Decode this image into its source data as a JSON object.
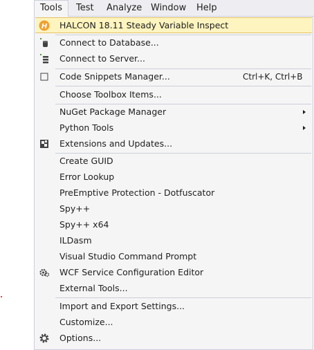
{
  "menubar": {
    "items": [
      {
        "label": "Tools"
      },
      {
        "label": "Test"
      },
      {
        "label": "Analyze"
      },
      {
        "label": "Window"
      },
      {
        "label": "Help"
      }
    ]
  },
  "tools_menu": {
    "items": [
      {
        "label": "HALCON 18.11 Steady Variable Inspect",
        "icon": "halcon-icon"
      },
      {
        "label": "Connect to Database...",
        "icon": "database-icon"
      },
      {
        "label": "Connect to Server...",
        "icon": "server-icon"
      },
      {
        "label": "Code Snippets Manager...",
        "shortcut": "Ctrl+K, Ctrl+B",
        "icon": "checkbox-icon"
      },
      {
        "label": "Choose Toolbox Items..."
      },
      {
        "label": "NuGet Package Manager",
        "submenu": true
      },
      {
        "label": "Python Tools",
        "submenu": true
      },
      {
        "label": "Extensions and Updates...",
        "icon": "extensions-icon"
      },
      {
        "label": "Create GUID"
      },
      {
        "label": "Error Lookup"
      },
      {
        "label": "PreEmptive Protection - Dotfuscator"
      },
      {
        "label": "Spy++"
      },
      {
        "label": "Spy++ x64"
      },
      {
        "label": "ILDasm"
      },
      {
        "label": "Visual Studio Command Prompt"
      },
      {
        "label": "WCF Service Configuration Editor",
        "icon": "wcf-gear-icon"
      },
      {
        "label": "External Tools..."
      },
      {
        "label": "Import and Export Settings..."
      },
      {
        "label": "Customize..."
      },
      {
        "label": "Options...",
        "icon": "gear-icon"
      }
    ]
  },
  "colors": {
    "menubar_bg": "#eeeef2",
    "menu_bg": "#f5f5f5",
    "highlight_bg": "#fdf4bf",
    "highlight_border": "#e5c365",
    "separator": "#cccedb",
    "halcon_orange": "#f0a030"
  }
}
